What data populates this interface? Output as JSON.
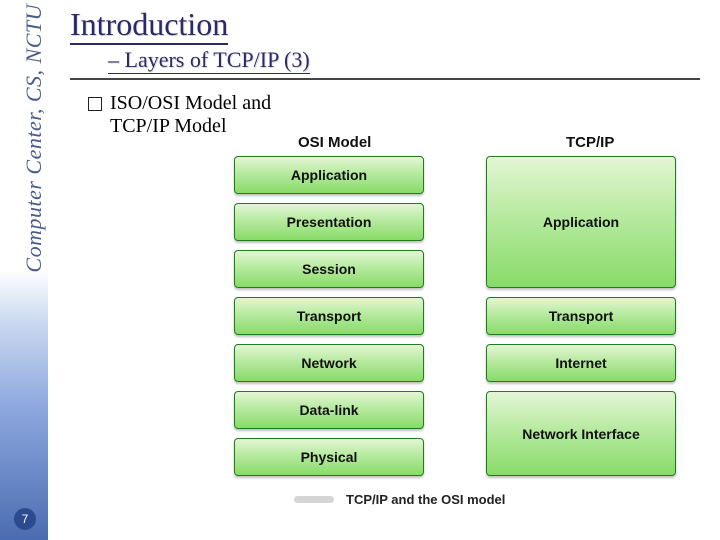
{
  "sidebar": {
    "org": "Computer Center, CS, NCTU",
    "page_number": "7"
  },
  "header": {
    "title": "Introduction",
    "subtitle_dash": "– ",
    "subtitle": "Layers of TCP/IP (3)"
  },
  "bullet": {
    "line1": "ISO/OSI Model and",
    "line2": "TCP/IP Model"
  },
  "diagram": {
    "osi_heading": "OSI Model",
    "tcp_heading": "TCP/IP",
    "osi_layers": [
      "Application",
      "Presentation",
      "Session",
      "Transport",
      "Network",
      "Data-link",
      "Physical"
    ],
    "tcp_layers": [
      "Application",
      "Transport",
      "Internet",
      "Network Interface"
    ],
    "caption": "TCP/IP and the OSI model"
  }
}
